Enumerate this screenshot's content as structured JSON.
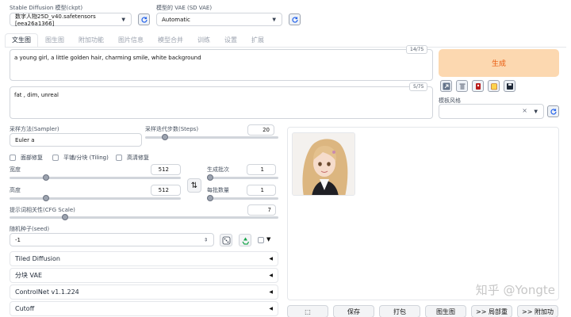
{
  "model": {
    "label": "Stable Diffusion 模型(ckpt)",
    "value": "数字人物25D_v40.safetensors [eea26a1366]"
  },
  "vae": {
    "label": "模型的 VAE (SD VAE)",
    "value": "Automatic"
  },
  "tabs": [
    "文生图",
    "图生图",
    "附加功能",
    "图片信息",
    "模型合并",
    "训练",
    "设置",
    "扩展"
  ],
  "prompt": {
    "text": "a young girl, a little golden hair, charming smile, white background",
    "counter": "14/75"
  },
  "negative_prompt": {
    "text": "fat , dim, unreal",
    "counter": "5/75"
  },
  "generate_label": "生成",
  "style": {
    "label": "模板风格",
    "clear": "×"
  },
  "sampler": {
    "label": "采样方法(Sampler)",
    "value": "Euler a"
  },
  "steps": {
    "label": "采样迭代步数(Steps)",
    "value": "20",
    "fraction": 0.13
  },
  "checkboxes": [
    "面部修复",
    "平铺/分块 (Tiling)",
    "高清修复"
  ],
  "width": {
    "label": "宽度",
    "value": "512",
    "fraction": 0.2
  },
  "height": {
    "label": "高度",
    "value": "512",
    "fraction": 0.2
  },
  "swap_icon": "⇅",
  "batch_count": {
    "label": "生成批次",
    "value": "1",
    "fraction": 0.0
  },
  "batch_size": {
    "label": "每批数量",
    "value": "1",
    "fraction": 0.0
  },
  "cfg": {
    "label": "提示词相关性(CFG Scale)",
    "value": "7",
    "fraction": 0.2
  },
  "seed": {
    "label": "随机种子(seed)",
    "value": "-1"
  },
  "accordions": [
    "Tiled Diffusion",
    "分块 VAE",
    "ControlNet v1.1.224",
    "Cutoff"
  ],
  "bottom_buttons": [
    "⬚",
    "保存",
    "打包",
    "图生图",
    ">> 局部重",
    ">> 附加功"
  ],
  "watermark": "知乎 @Yongte",
  "colors": {
    "generate_bg": "#fcd8b0",
    "generate_text": "#e8590c",
    "accent": "#f97316"
  }
}
